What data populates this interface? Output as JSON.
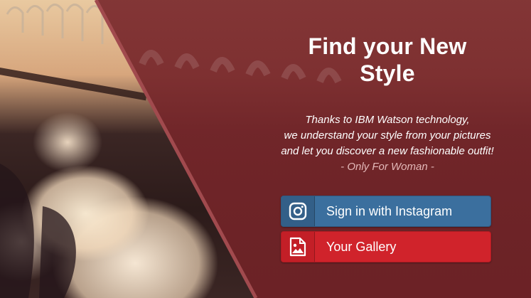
{
  "hero": {
    "title_line1": "Find your New",
    "title_line2": "Style",
    "desc_line1": "Thanks to IBM Watson technology,",
    "desc_line2": "we understand your style from your pictures",
    "desc_line3": "and let you discover a new fashionable outfit!",
    "note": "- Only For Woman -"
  },
  "buttons": {
    "instagram_label": "Sign in with Instagram",
    "instagram_icon": "instagram-icon",
    "gallery_label": "Your Gallery",
    "gallery_icon": "image-file-icon"
  },
  "colors": {
    "overlay": "#7a292d",
    "instagram_button": "#3b6f9e",
    "gallery_button": "#d0232b"
  }
}
